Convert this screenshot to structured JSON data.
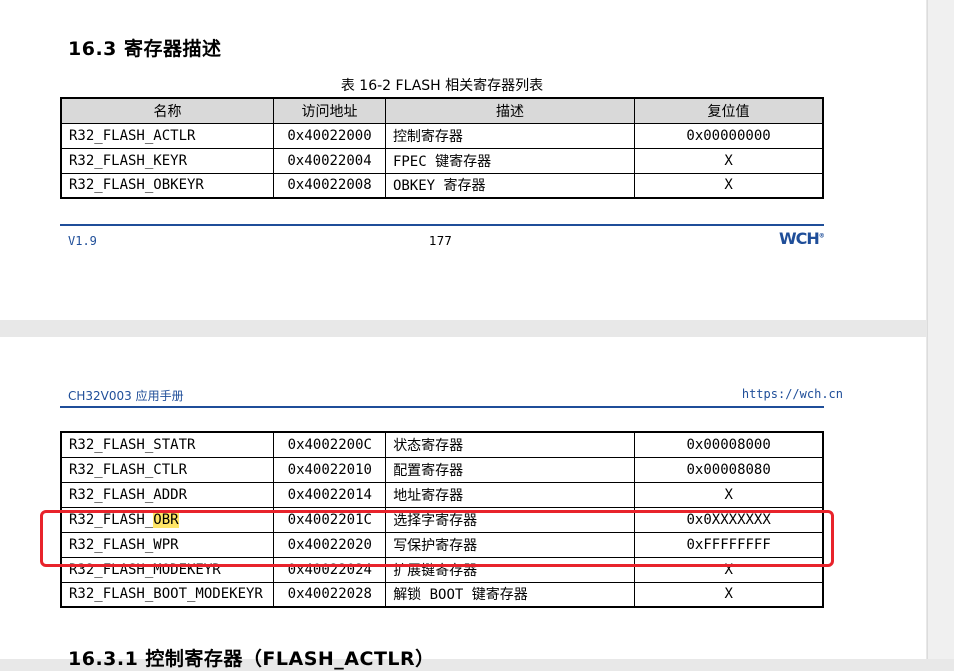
{
  "page1": {
    "section_title": "16.3 寄存器描述",
    "table_caption": "表 16-2 FLASH 相关寄存器列表",
    "headers": [
      "名称",
      "访问地址",
      "描述",
      "复位值"
    ],
    "rows": [
      {
        "name": "R32_FLASH_ACTLR",
        "addr": "0x40022000",
        "desc": "控制寄存器",
        "reset": "0x00000000"
      },
      {
        "name": "R32_FLASH_KEYR",
        "addr": "0x40022004",
        "desc": "FPEC 键寄存器",
        "reset": "X"
      },
      {
        "name": "R32_FLASH_OBKEYR",
        "addr": "0x40022008",
        "desc": "OBKEY 寄存器",
        "reset": "X"
      }
    ],
    "footer_version": "V1.9",
    "page_number": "177",
    "logo_text": "WCH",
    "logo_mark": "®"
  },
  "page2": {
    "header_left": "CH32V003 应用手册",
    "header_right": "https://wch.cn",
    "rows": [
      {
        "name": "R32_FLASH_STATR",
        "addr": "0x4002200C",
        "desc": "状态寄存器",
        "reset": "0x00008000"
      },
      {
        "name": "R32_FLASH_CTLR",
        "addr": "0x40022010",
        "desc": "配置寄存器",
        "reset": "0x00008080"
      },
      {
        "name": "R32_FLASH_ADDR",
        "addr": "0x40022014",
        "desc": "地址寄存器",
        "reset": "X"
      },
      {
        "name_prefix": "R32_FLASH_",
        "name_highlight": "OBR",
        "addr": "0x4002201C",
        "desc": "选择字寄存器",
        "reset": "0x0XXXXXXX"
      },
      {
        "name": "R32_FLASH_WPR",
        "addr": "0x40022020",
        "desc": "写保护寄存器",
        "reset": "0xFFFFFFFF"
      },
      {
        "name": "R32_FLASH_MODEKEYR",
        "addr": "0x40022024",
        "desc": "扩展键寄存器",
        "reset": "X"
      },
      {
        "name": "R32_FLASH_BOOT_MODEKEYR",
        "addr": "0x40022028",
        "desc": "解锁 BOOT 键寄存器",
        "reset": "X"
      }
    ],
    "next_section_title": "16.3.1 控制寄存器（FLASH_ACTLR）"
  },
  "colors": {
    "annotation_box": "#e8232b",
    "highlight": "#ffe566",
    "brand_blue": "#1f4e99"
  }
}
